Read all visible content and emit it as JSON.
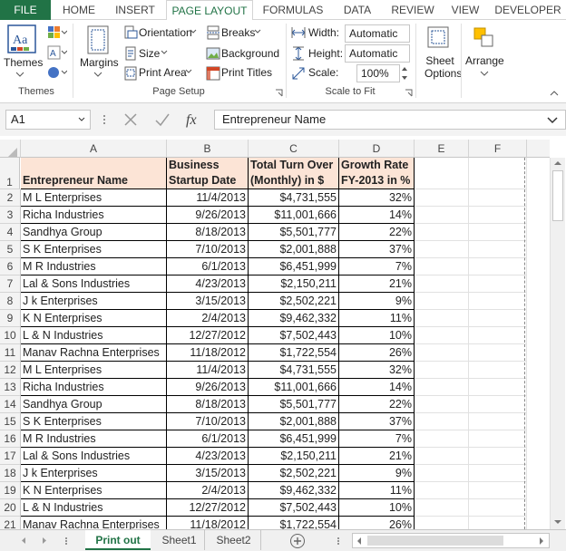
{
  "tabs": [
    "FILE",
    "HOME",
    "INSERT",
    "PAGE LAYOUT",
    "FORMULAS",
    "DATA",
    "REVIEW",
    "VIEW",
    "DEVELOPER"
  ],
  "active_tab": "PAGE LAYOUT",
  "ribbon": {
    "themes": {
      "themes_label": "Themes",
      "group": "Themes"
    },
    "page_setup": {
      "margins": "Margins",
      "orientation": "Orientation",
      "size": "Size",
      "print_area": "Print Area",
      "breaks": "Breaks",
      "background": "Background",
      "print_titles": "Print Titles",
      "group": "Page Setup"
    },
    "scale_to_fit": {
      "width_label": "Width:",
      "width_value": "Automatic",
      "height_label": "Height:",
      "height_value": "Automatic",
      "scale_label": "Scale:",
      "scale_value": "100%",
      "group": "Scale to Fit"
    },
    "sheet_options": "Sheet Options",
    "arrange": "Arrange"
  },
  "formula_bar": {
    "name_box": "A1",
    "formula": "Entrepreneur Name"
  },
  "columns": [
    "A",
    "B",
    "C",
    "D",
    "E",
    "F"
  ],
  "header_row": {
    "a": "Entrepreneur Name",
    "b1": "Business",
    "b2": "Startup Date",
    "c1": "Total Turn Over",
    "c2": "(Monthly) in $",
    "d1": "Growth Rate",
    "d2": "FY-2013 in %"
  },
  "rows": [
    {
      "n": "2",
      "a": "M L Enterprises",
      "b": "11/4/2013",
      "c": "$4,731,555",
      "d": "32%"
    },
    {
      "n": "3",
      "a": "Richa Industries",
      "b": "9/26/2013",
      "c": "$11,001,666",
      "d": "14%"
    },
    {
      "n": "4",
      "a": "Sandhya Group",
      "b": "8/18/2013",
      "c": "$5,501,777",
      "d": "22%"
    },
    {
      "n": "5",
      "a": "S K Enterprises",
      "b": "7/10/2013",
      "c": "$2,001,888",
      "d": "37%"
    },
    {
      "n": "6",
      "a": "M R Industries",
      "b": "6/1/2013",
      "c": "$6,451,999",
      "d": "7%"
    },
    {
      "n": "7",
      "a": "Lal & Sons Industries",
      "b": "4/23/2013",
      "c": "$2,150,211",
      "d": "21%"
    },
    {
      "n": "8",
      "a": "J k Enterprises",
      "b": "3/15/2013",
      "c": "$2,502,221",
      "d": "9%"
    },
    {
      "n": "9",
      "a": "K N Enterprises",
      "b": "2/4/2013",
      "c": "$9,462,332",
      "d": "11%"
    },
    {
      "n": "10",
      "a": "L & N Industries",
      "b": "12/27/2012",
      "c": "$7,502,443",
      "d": "10%"
    },
    {
      "n": "11",
      "a": "Manav Rachna Enterprises",
      "b": "11/18/2012",
      "c": "$1,722,554",
      "d": "26%"
    },
    {
      "n": "12",
      "a": "M L Enterprises",
      "b": "11/4/2013",
      "c": "$4,731,555",
      "d": "32%"
    },
    {
      "n": "13",
      "a": "Richa Industries",
      "b": "9/26/2013",
      "c": "$11,001,666",
      "d": "14%"
    },
    {
      "n": "14",
      "a": "Sandhya Group",
      "b": "8/18/2013",
      "c": "$5,501,777",
      "d": "22%"
    },
    {
      "n": "15",
      "a": "S K Enterprises",
      "b": "7/10/2013",
      "c": "$2,001,888",
      "d": "37%"
    },
    {
      "n": "16",
      "a": "M R Industries",
      "b": "6/1/2013",
      "c": "$6,451,999",
      "d": "7%"
    },
    {
      "n": "17",
      "a": "Lal & Sons Industries",
      "b": "4/23/2013",
      "c": "$2,150,211",
      "d": "21%"
    },
    {
      "n": "18",
      "a": "J k Enterprises",
      "b": "3/15/2013",
      "c": "$2,502,221",
      "d": "9%"
    },
    {
      "n": "19",
      "a": "K N Enterprises",
      "b": "2/4/2013",
      "c": "$9,462,332",
      "d": "11%"
    },
    {
      "n": "20",
      "a": "L & N Industries",
      "b": "12/27/2012",
      "c": "$7,502,443",
      "d": "10%"
    },
    {
      "n": "21",
      "a": "Manav Rachna Enterprises",
      "b": "11/18/2012",
      "c": "$1,722,554",
      "d": "26%"
    }
  ],
  "sheet_tabs": [
    "Print out",
    "Sheet1",
    "Sheet2"
  ],
  "active_sheet": "Print out",
  "colors": {
    "accent": "#217346",
    "header_fill": "#fce4d6"
  }
}
